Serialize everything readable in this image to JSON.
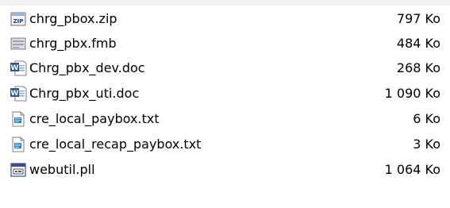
{
  "files": [
    {
      "name": "chrg_pbox.zip",
      "size": "797 Ko",
      "icon": "zip-archive-icon"
    },
    {
      "name": "chrg_pbx.fmb",
      "size": "484 Ko",
      "icon": "form-file-icon"
    },
    {
      "name": "Chrg_pbx_dev.doc",
      "size": "268 Ko",
      "icon": "word-document-icon"
    },
    {
      "name": "Chrg_pbx_uti.doc",
      "size": "1 090 Ko",
      "icon": "word-document-icon"
    },
    {
      "name": "cre_local_paybox.txt",
      "size": "6 Ko",
      "icon": "text-file-icon"
    },
    {
      "name": "cre_local_recap_paybox.txt",
      "size": "3 Ko",
      "icon": "text-file-icon"
    },
    {
      "name": "webutil.pll",
      "size": "1 064 Ko",
      "icon": "library-file-icon"
    }
  ],
  "colors": {
    "list_background": "#ffffff",
    "pane_background": "#f0f0f0",
    "word_blue": "#2b5797",
    "text_file_blue": "#2a7ad0"
  }
}
